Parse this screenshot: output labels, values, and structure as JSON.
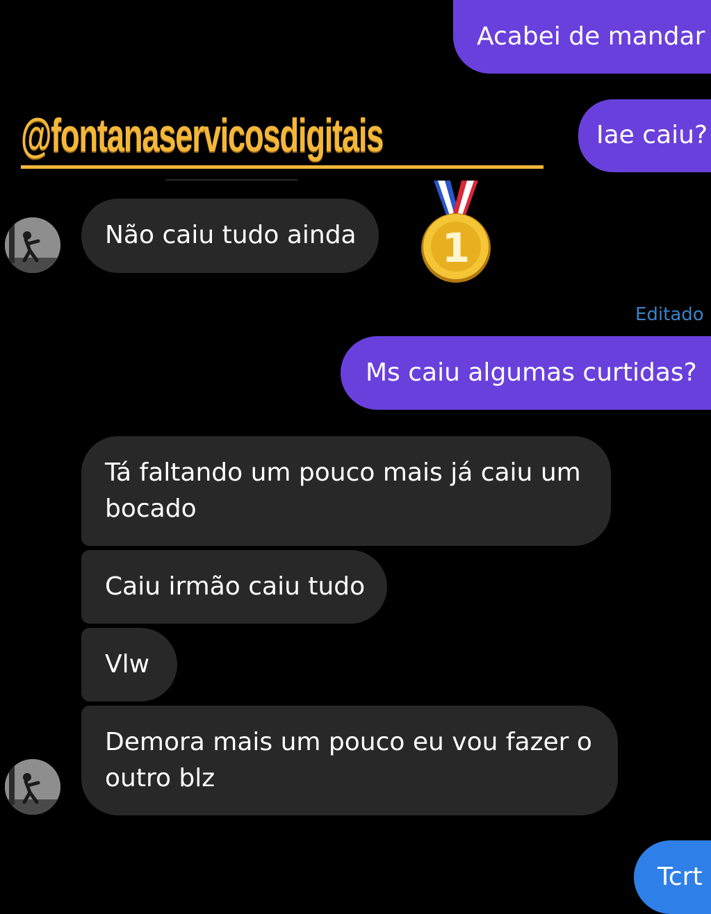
{
  "watermark": {
    "text": "@fontanaservicosdigitais"
  },
  "medal": {
    "icon": "first-place-medal-icon",
    "number": "1"
  },
  "messages": {
    "m1": {
      "text": "Acabei de mandar",
      "direction": "outgoing"
    },
    "m2": {
      "text": "Iae caiu?",
      "direction": "outgoing"
    },
    "m3": {
      "text": "Não caiu tudo ainda",
      "direction": "incoming"
    },
    "edited_label": "Editado",
    "m4": {
      "text": "Ms caiu algumas curtidas?",
      "direction": "outgoing"
    },
    "m5": {
      "line1": "Tá faltando um pouco mais já caiu um",
      "line2": "bocado",
      "direction": "incoming"
    },
    "m6": {
      "text": "Caiu irmão caiu tudo",
      "direction": "incoming"
    },
    "m7": {
      "text": "Vlw",
      "direction": "incoming"
    },
    "m8": {
      "line1": "Demora mais um pouco eu vou fazer o",
      "line2": "outro blz",
      "direction": "incoming"
    },
    "m9": {
      "text": "Tcrt",
      "direction": "outgoing"
    }
  },
  "colors": {
    "background": "#000000",
    "outgoing_bubble": "#6a40dc",
    "outgoing_bubble_last": "#2f7fe8",
    "incoming_bubble": "#282828",
    "edited_label": "#3b82c8",
    "watermark": "#f3b73a"
  }
}
